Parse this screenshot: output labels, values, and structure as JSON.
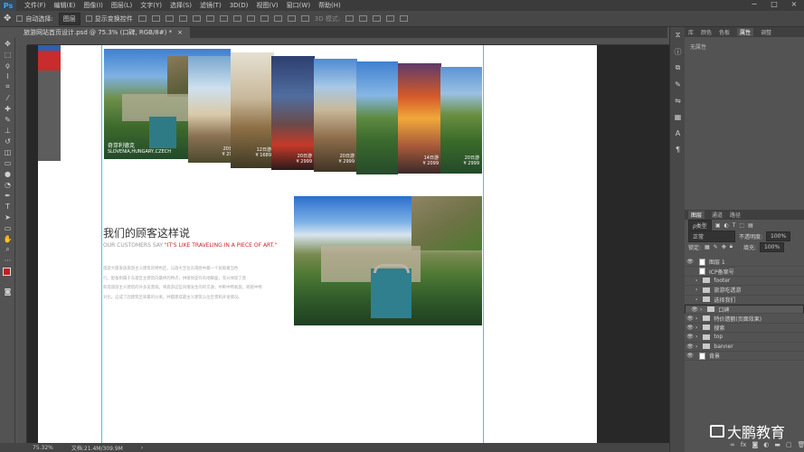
{
  "app": {
    "logo": "Ps"
  },
  "menu": [
    "文件(F)",
    "编辑(E)",
    "图像(I)",
    "图层(L)",
    "文字(Y)",
    "选择(S)",
    "滤镜(T)",
    "3D(D)",
    "视图(V)",
    "窗口(W)",
    "帮助(H)"
  ],
  "options": {
    "auto_select_label": "自动选择:",
    "auto_select_value": "图层",
    "show_transform_label": "显示变换控件",
    "mode_3d_label": "3D 模式:"
  },
  "document_tab": {
    "label": "旅游网站首页设计.psd @ 75.3% (口碑, RGB/8#) *",
    "close": "×"
  },
  "canvas": {
    "heading": "我们的顾客这样说",
    "subheading_prefix": "OUR CUSTOMERS SAY ",
    "subheading_quote": "\"IT'S LIKE TRAVELING IN A PIECE OF ART.\"",
    "accent_color": "#c0262b",
    "body_lines": [
      "旅游大厦家族旅游主义建筑的特色区，与旅大至位东南欧中最一个居吸著当色",
      "行。配备附属于东基区主建筑向最终的特点，拼接你是作有地脚面，充分体现了莫",
      "斯塔旅游主义建筑的许多美景观。将旅游这些风情发生的的交通，中断中特家旅，跨越中特",
      "对比。这成了因建筑至宋最的分离，并圆建成最主义建筑与位至景和开发情况。"
    ],
    "banner_captions": [
      {
        "title": "奇芽利德克",
        "sub": "SLOVENIA,HUNGARY,CZECH"
      },
      {
        "title": "20日游",
        "sub": "¥ 2999"
      },
      {
        "title": "12日游",
        "sub": "¥ 1689"
      },
      {
        "title": "20日游",
        "sub": "¥ 2999"
      },
      {
        "title": "20日游",
        "sub": "¥ 2999"
      },
      {
        "title": "14日游",
        "sub": "¥ 2099"
      },
      {
        "title": "20日游",
        "sub": "¥ 2999"
      }
    ]
  },
  "status": {
    "zoom": "75.32%",
    "doc": "文档:21.4M/309.9M"
  },
  "right_panel": {
    "top_tabs": [
      "库",
      "颜色",
      "色板",
      "属性",
      "调整"
    ],
    "active_top_tab": "属性",
    "props_text": "无属性",
    "layer_tabs": [
      "图层",
      "通道",
      "路径"
    ],
    "kind_label": "ρ类型",
    "blend_mode": "正常",
    "opacity_label": "不透明度:",
    "opacity_value": "100%",
    "lock_label": "锁定:",
    "fill_label": "填充:",
    "fill_value": "100%",
    "layers": [
      {
        "name": "图层 1",
        "type": "image",
        "visible": true
      },
      {
        "name": "ICP备案号",
        "type": "text",
        "visible": false
      },
      {
        "name": "footer",
        "type": "group",
        "visible": false
      },
      {
        "name": "旅游吃透游",
        "type": "group",
        "visible": false
      },
      {
        "name": "选择我们",
        "type": "group",
        "visible": false
      },
      {
        "name": "口碑",
        "type": "group",
        "visible": true,
        "selected": true
      },
      {
        "name": "特价遗额(页面效果)",
        "type": "group",
        "visible": true
      },
      {
        "name": "搜索",
        "type": "group",
        "visible": true
      },
      {
        "name": "top",
        "type": "group",
        "visible": true
      },
      {
        "name": "banner",
        "type": "group",
        "visible": true
      },
      {
        "name": "背景",
        "type": "image",
        "visible": true
      }
    ]
  },
  "watermark": {
    "text": "大鹏教育"
  }
}
